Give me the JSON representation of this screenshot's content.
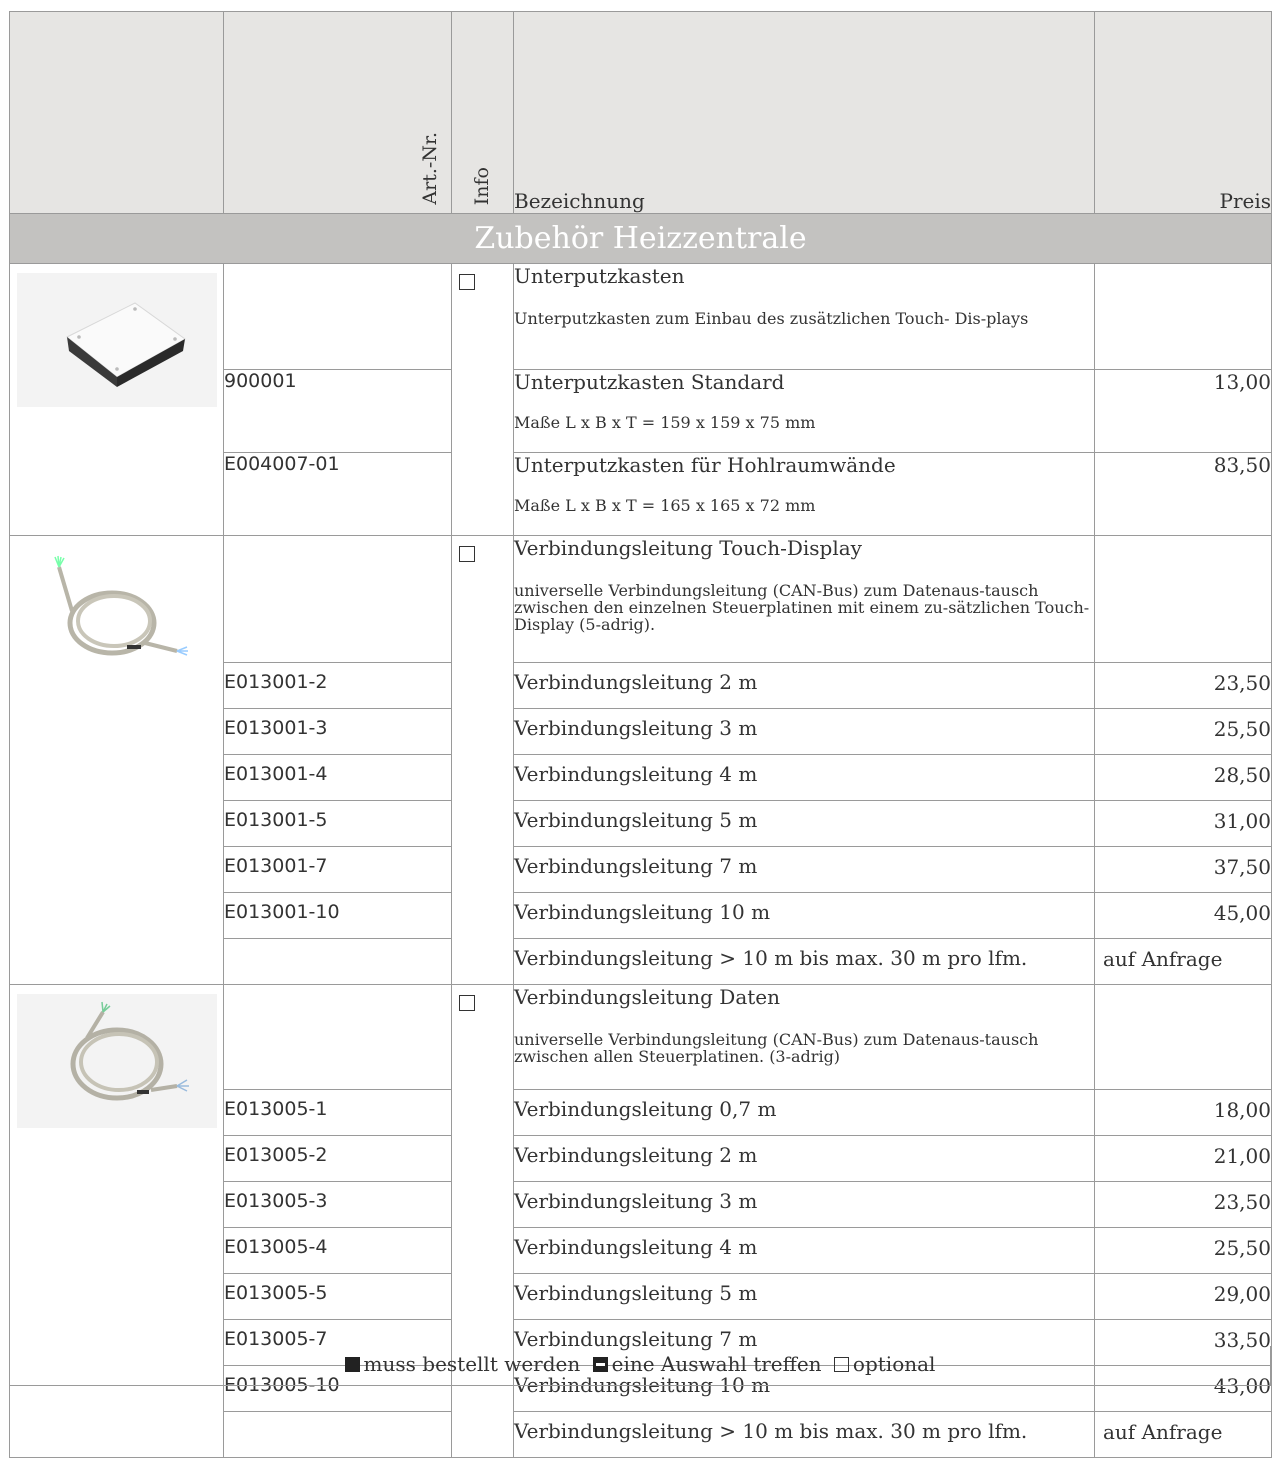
{
  "header": {
    "art_nr": "Art.-Nr.",
    "info": "Info",
    "bezeichnung": "Bezeichnung",
    "preis": "Preis"
  },
  "section_title": "Zubehör Heizzentrale",
  "groups": [
    {
      "title": "Unterputzkasten",
      "description": "Unterputzkasten zum Einbau des zusätzlichen Touch- Dis-plays",
      "items": [
        {
          "art": "900001",
          "name": "Unterputzkasten Standard",
          "note": "Maße L x B x T = 159 x 159 x 75 mm",
          "price": "13,00"
        },
        {
          "art": "E004007-01",
          "name": "Unterputzkasten für Hohlraumwände",
          "note": "Maße L x B x T = 165 x 165 x 72 mm",
          "price": "83,50"
        }
      ]
    },
    {
      "title": "Verbindungsleitung Touch-Display",
      "description": "universelle Verbindungsleitung (CAN-Bus) zum Datenaus-tausch zwischen den einzelnen Steuerplatinen mit einem zu-sätzlichen Touch-Display (5-adrig).",
      "items": [
        {
          "art": "E013001-2",
          "name": "Verbindungsleitung 2 m",
          "price": "23,50"
        },
        {
          "art": "E013001-3",
          "name": "Verbindungsleitung 3 m",
          "price": "25,50"
        },
        {
          "art": "E013001-4",
          "name": "Verbindungsleitung 4 m",
          "price": "28,50"
        },
        {
          "art": "E013001-5",
          "name": "Verbindungsleitung 5 m",
          "price": "31,00"
        },
        {
          "art": "E013001-7",
          "name": "Verbindungsleitung 7 m",
          "price": "37,50"
        },
        {
          "art": "E013001-10",
          "name": "Verbindungsleitung 10 m",
          "price": "45,00"
        },
        {
          "art": "",
          "name": "Verbindungsleitung > 10 m bis max. 30 m pro lfm.",
          "price": "auf Anfrage"
        }
      ]
    },
    {
      "title": "Verbindungsleitung Daten",
      "description": "universelle Verbindungsleitung (CAN-Bus) zum Datenaus-tausch zwischen allen Steuerplatinen. (3-adrig)",
      "items": [
        {
          "art": "E013005-1",
          "name": "Verbindungsleitung 0,7 m",
          "price": "18,00"
        },
        {
          "art": "E013005-2",
          "name": "Verbindungsleitung 2 m",
          "price": "21,00"
        },
        {
          "art": "E013005-3",
          "name": "Verbindungsleitung 3 m",
          "price": "23,50"
        },
        {
          "art": "E013005-4",
          "name": "Verbindungsleitung 4 m",
          "price": "25,50"
        },
        {
          "art": "E013005-5",
          "name": "Verbindungsleitung 5 m",
          "price": "29,00"
        },
        {
          "art": "E013005-7",
          "name": "Verbindungsleitung 7 m",
          "price": "33,50"
        },
        {
          "art": "E013005-10",
          "name": "Verbindungsleitung 10 m",
          "price": "43,00"
        },
        {
          "art": "",
          "name": "Verbindungsleitung > 10 m bis max. 30 m pro lfm.",
          "price": "auf Anfrage"
        }
      ]
    }
  ],
  "legend": {
    "must": "muss bestellt werden",
    "choose": "eine Auswahl treffen",
    "optional": "optional"
  },
  "colors": {
    "header_bg": "#e6e5e3",
    "section_bg": "#c3c2c0",
    "border": "#9a9a9a"
  }
}
